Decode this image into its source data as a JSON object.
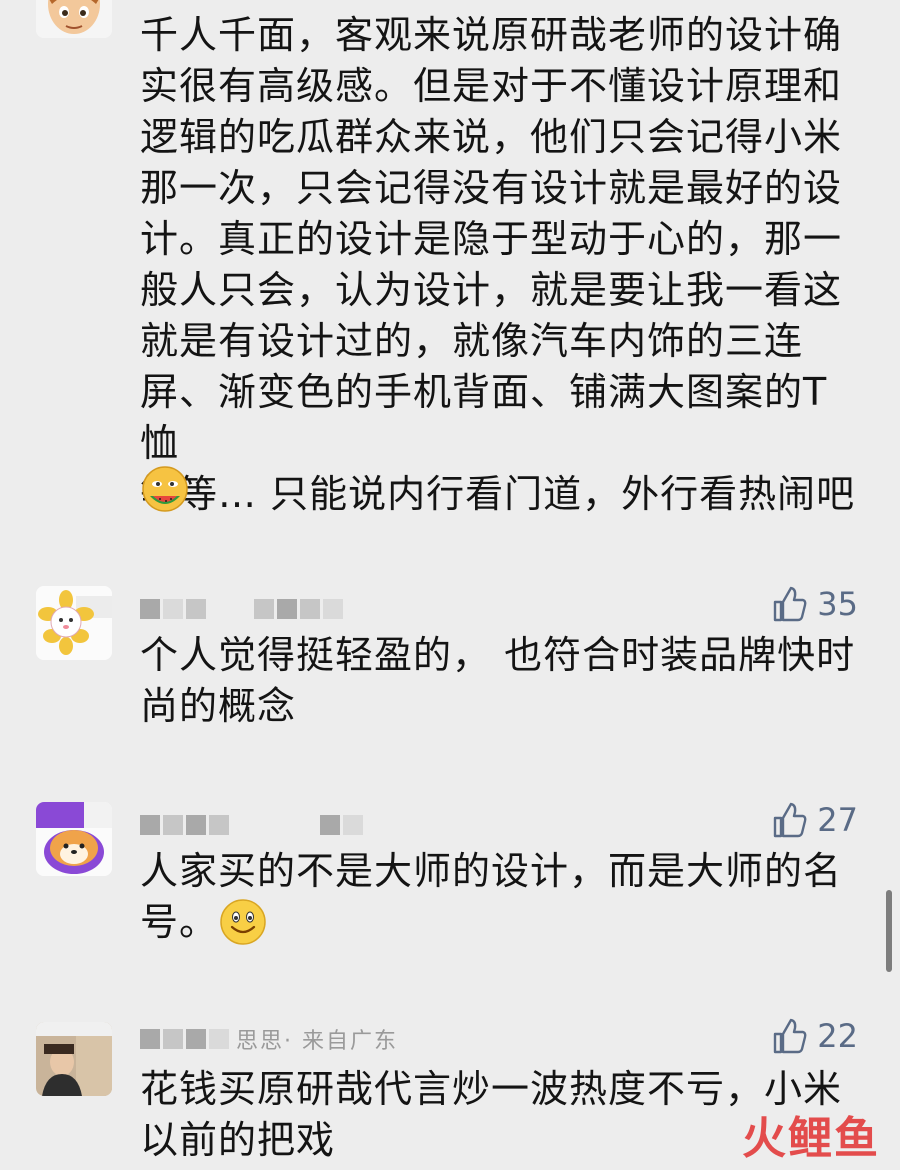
{
  "comments": [
    {
      "text": "千人千面，客观来说原研哉老师的设计确\n实很有高级感。但是对于不懂设计原理和\n逻辑的吃瓜群众来说，他们只会记得小米\n那一次，只会记得没有设计就是最好的设\n计。真正的设计是隐于型动于心的，那一\n般人只会，认为设计，就是要让我一看这\n就是有设计过的，就像汽车内饰的三连\n屏、渐变色的手机背面、铺满大图案的T恤\n等等… 只能说内行看门道，外行看热闹吧",
      "emoji": "eating-melon-emoji"
    },
    {
      "likes": "35",
      "text": "个人觉得挺轻盈的， 也符合时装品牌快时\n尚的概念"
    },
    {
      "likes": "27",
      "text": "人家买的不是大师的设计，而是大师的名\n号。",
      "emoji": "smile-emoji"
    },
    {
      "likes": "22",
      "text": "花钱买原研哉代言炒一波热度不亏，小米\n以前的把戏",
      "username_fragment": "思思· 来自广东"
    }
  ],
  "watermark": {
    "c1": "火",
    "c2": "鲤",
    "c3": "鱼"
  },
  "colors": {
    "background": "#ededed",
    "text": "#141414",
    "like": "#5a6b86"
  }
}
